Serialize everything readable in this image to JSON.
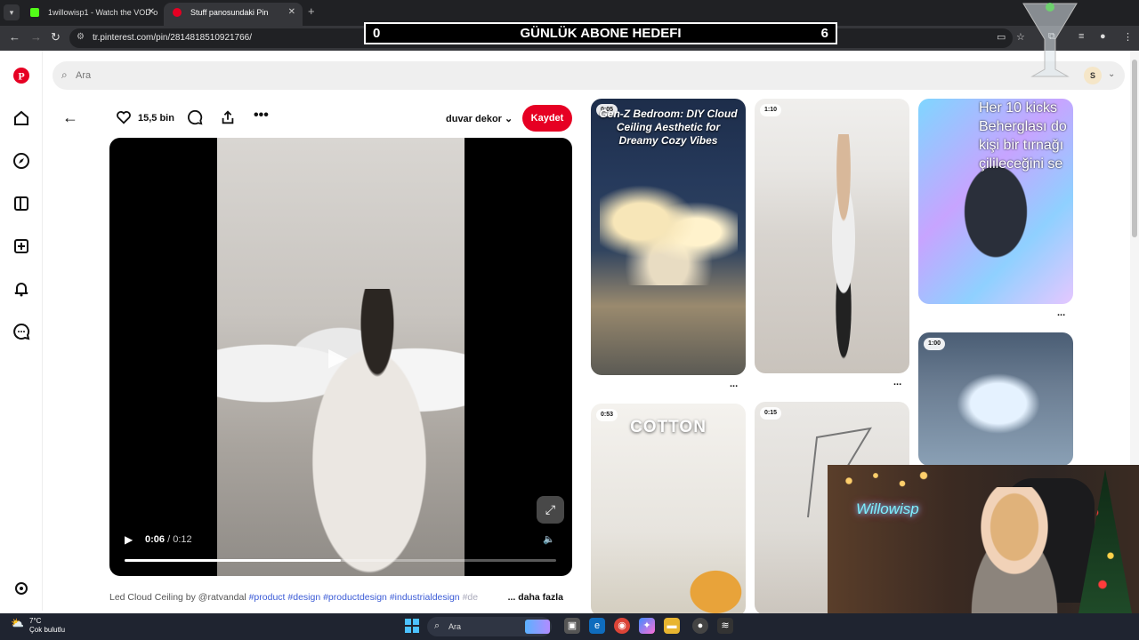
{
  "browser": {
    "tabs": [
      {
        "label": "1willowisp1 - Watch the VOD o",
        "favicon": "kick-icon",
        "color": "#53fc18"
      },
      {
        "label": "Stuff panosundaki Pin",
        "favicon": "pinterest-icon",
        "color": "#e60023"
      }
    ],
    "url": "tr.pinterest.com/pin/2814818510921766/"
  },
  "overlay": {
    "goal_left": "0",
    "goal_title": "GÜNLÜK ABONE HEDEFI",
    "goal_right": "6"
  },
  "search": {
    "placeholder": "Ara"
  },
  "user": {
    "initial": "S"
  },
  "pin": {
    "like_count": "15,5 bin",
    "board": "duvar dekor",
    "save_label": "Kaydet",
    "video_current": "0:06",
    "video_total": "/ 0:12",
    "progress": 0.5,
    "description_prefix": "Led Cloud Ceiling by @ratvandal",
    "tags": [
      "#product",
      "#design",
      "#productdesign",
      "#industrialdesign",
      "#de"
    ],
    "more_label": "... daha fazla"
  },
  "grid": {
    "card1": {
      "duration": "0:05",
      "title": "Gen-Z Bedroom: DIY Cloud Ceiling Aesthetic for Dreamy Cozy Vibes"
    },
    "card2": {
      "duration": "1:10"
    },
    "card3": {
      "text_lines": [
        "Her 10 kicks",
        "Beherglası do",
        "kişi bir tırnağı",
        "çilileceğini se"
      ]
    },
    "card4": {
      "duration": "1:00"
    },
    "card5": {
      "duration": "0:53",
      "title": "COTTON"
    },
    "card6": {
      "duration": "0:15"
    },
    "more_icon": "..."
  },
  "webcam": {
    "neon_sign": "Willowisp"
  },
  "taskbar": {
    "temperature": "7°C",
    "condition": "Çok bulutlu",
    "search_placeholder": "Ara"
  }
}
